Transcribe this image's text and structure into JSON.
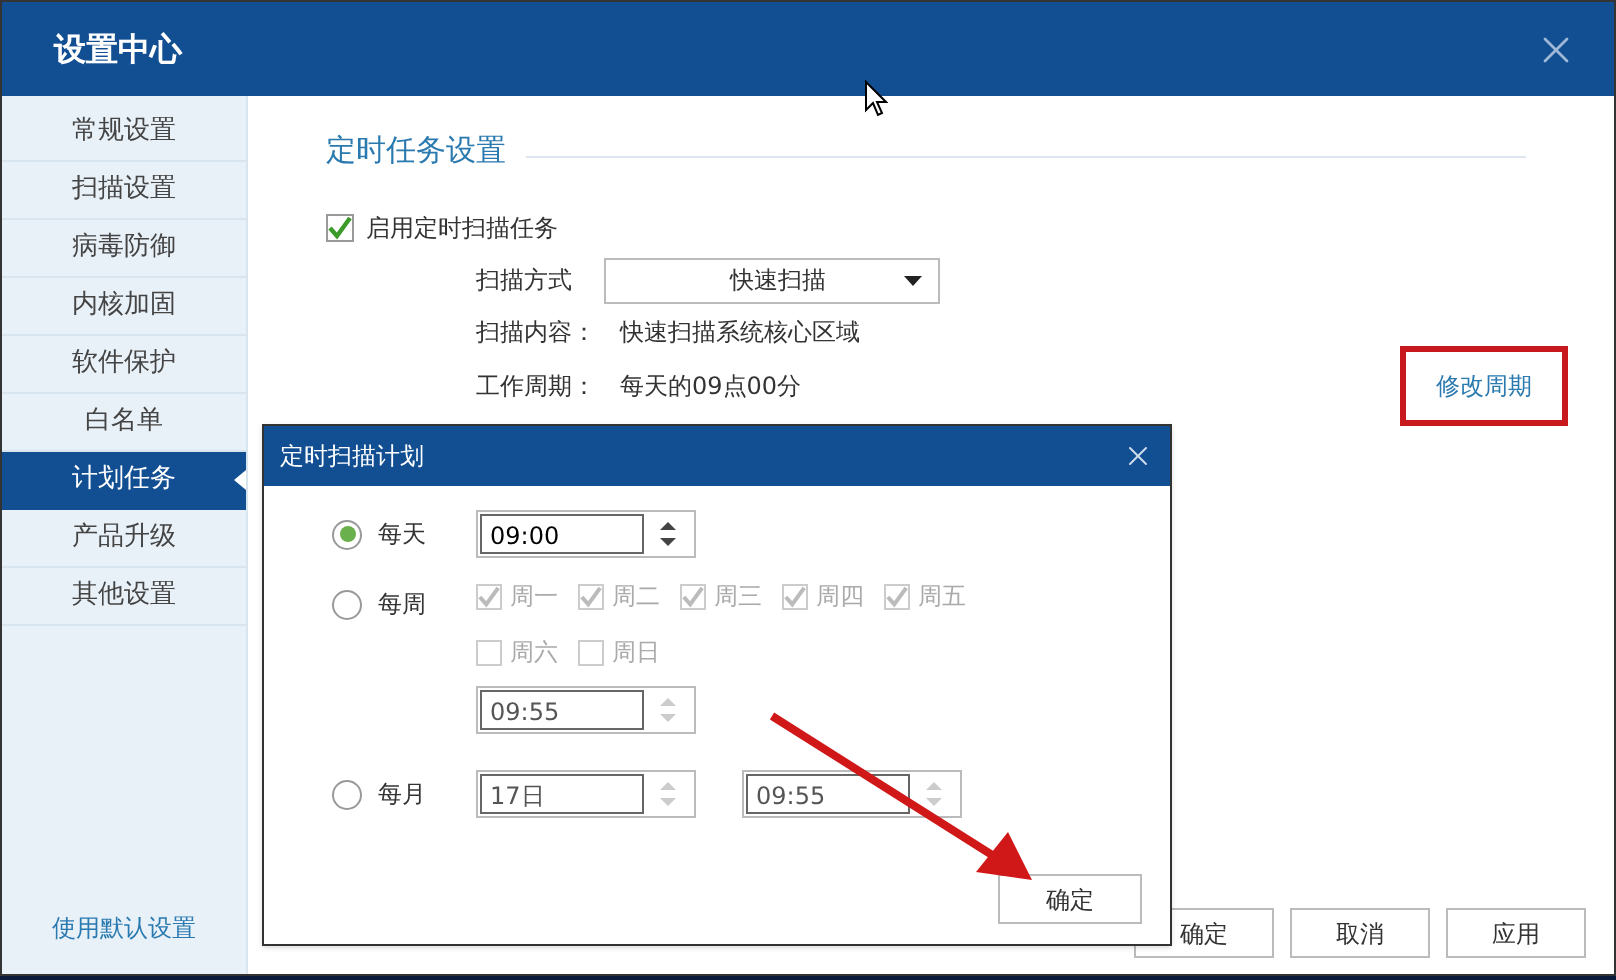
{
  "window": {
    "title": "设置中心"
  },
  "sidebar": {
    "items": [
      {
        "label": "常规设置",
        "selected": false
      },
      {
        "label": "扫描设置",
        "selected": false
      },
      {
        "label": "病毒防御",
        "selected": false
      },
      {
        "label": "内核加固",
        "selected": false
      },
      {
        "label": "软件保护",
        "selected": false
      },
      {
        "label": "白名单",
        "selected": false
      },
      {
        "label": "计划任务",
        "selected": true
      },
      {
        "label": "产品升级",
        "selected": false
      },
      {
        "label": "其他设置",
        "selected": false
      }
    ],
    "footer_link": "使用默认设置"
  },
  "section": {
    "title": "定时任务设置",
    "enable": {
      "label": "启用定时扫描任务",
      "checked": true
    },
    "scan_mode": {
      "label": "扫描方式",
      "value": "快速扫描"
    },
    "scan_content": {
      "label": "扫描内容：",
      "value": "快速扫描系统核心区域"
    },
    "work_cycle": {
      "label": "工作周期：",
      "value": "每天的09点00分"
    },
    "change_link": {
      "label": "修改周期",
      "highlighted": true
    }
  },
  "footer_buttons": [
    "确定",
    "取消",
    "应用"
  ],
  "dialog": {
    "title": "定时扫描计划",
    "options": [
      {
        "kind": "daily",
        "label": "每天",
        "selected": true,
        "time": "09:00"
      },
      {
        "kind": "weekly",
        "label": "每周",
        "selected": false,
        "days": [
          {
            "label": "周一",
            "checked": true
          },
          {
            "label": "周二",
            "checked": true
          },
          {
            "label": "周三",
            "checked": true
          },
          {
            "label": "周四",
            "checked": true
          },
          {
            "label": "周五",
            "checked": true
          },
          {
            "label": "周六",
            "checked": false
          },
          {
            "label": "周日",
            "checked": false
          }
        ],
        "time": "09:55"
      },
      {
        "kind": "monthly",
        "label": "每月",
        "selected": false,
        "day": "17日",
        "time": "09:55"
      }
    ],
    "confirm": "确定"
  }
}
